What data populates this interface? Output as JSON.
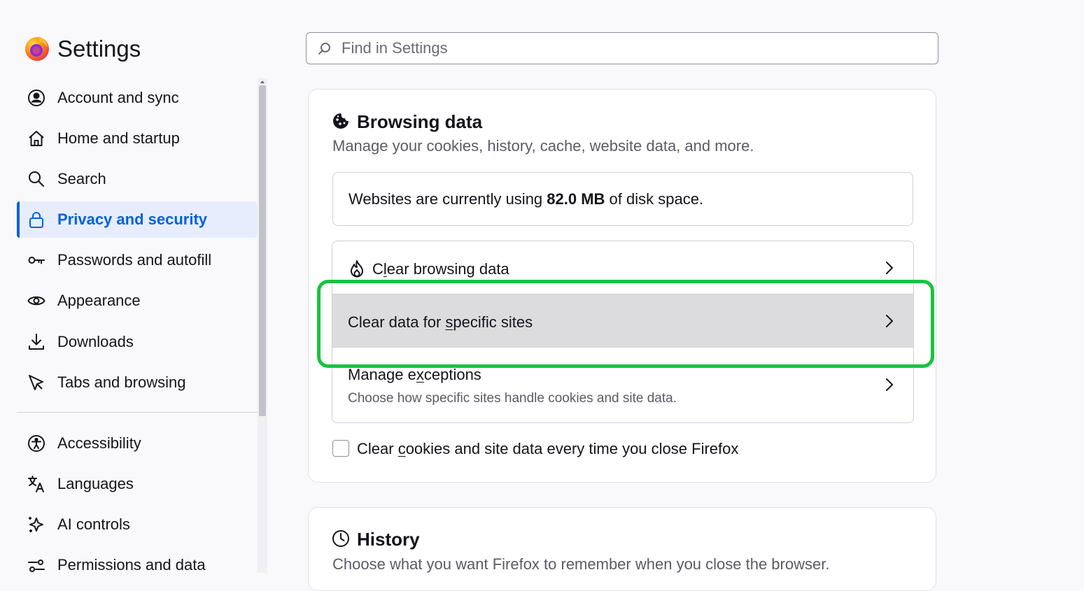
{
  "header": {
    "title": "Settings",
    "search_placeholder": "Find in Settings"
  },
  "sidebar": {
    "items": [
      {
        "label": "Account and sync",
        "icon": "account-icon"
      },
      {
        "label": "Home and startup",
        "icon": "home-icon"
      },
      {
        "label": "Search",
        "icon": "search-icon"
      },
      {
        "label": "Privacy and security",
        "icon": "lock-icon",
        "selected": true
      },
      {
        "label": "Passwords and autofill",
        "icon": "key-icon"
      },
      {
        "label": "Appearance",
        "icon": "eye-icon"
      },
      {
        "label": "Downloads",
        "icon": "download-icon"
      },
      {
        "label": "Tabs and browsing",
        "icon": "cursor-icon"
      }
    ],
    "items2": [
      {
        "label": "Accessibility",
        "icon": "accessibility-icon"
      },
      {
        "label": "Languages",
        "icon": "translate-icon"
      },
      {
        "label": "AI controls",
        "icon": "sparkle-icon"
      },
      {
        "label": "Permissions and data",
        "icon": "permissions-icon"
      }
    ]
  },
  "browsing_data": {
    "title": "Browsing data",
    "description": "Manage your cookies, history, cache, website data, and more.",
    "disk_prefix": "Websites are currently using ",
    "disk_amount": "82.0 MB",
    "disk_suffix": " of disk space.",
    "clear_browsing": {
      "pre": "C",
      "key": "l",
      "post": "ear browsing data"
    },
    "clear_sites": {
      "pre": "Clear data for ",
      "key": "s",
      "post": "pecific sites"
    },
    "manage_exceptions": {
      "pre": "Manage e",
      "key": "x",
      "post": "ceptions",
      "sub": "Choose how specific sites handle cookies and site data."
    },
    "checkbox": {
      "pre": "Clear ",
      "key": "c",
      "post": "ookies and site data every time you close Firefox",
      "checked": false
    }
  },
  "history": {
    "title": "History",
    "description": "Choose what you want Firefox to remember when you close the browser."
  },
  "colors": {
    "accent": "#0061e0",
    "highlight": "#17c43f"
  }
}
